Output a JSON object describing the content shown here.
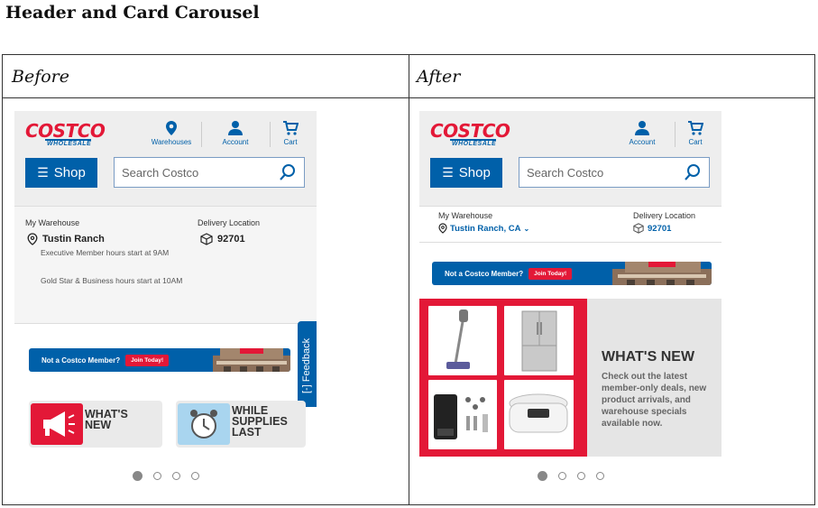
{
  "doc_title": "Header and Card Carousel",
  "columns": {
    "before": "Before",
    "after": "After"
  },
  "header": {
    "logo_main": "COSTCO",
    "logo_sub": "WHOLESALE",
    "warehouses_label": "Warehouses",
    "account_label": "Account",
    "cart_label": "Cart",
    "shop_label": "Shop",
    "search_placeholder": "Search Costco"
  },
  "before": {
    "my_warehouse_label": "My Warehouse",
    "warehouse_name": "Tustin Ranch",
    "delivery_label": "Delivery Location",
    "zip": "92701",
    "note_exec": "Executive Member hours start at 9AM",
    "note_gold": "Gold Star & Business hours start at 10AM",
    "banner_text": "Not a Costco Member?",
    "join_label": "Join Today!",
    "feedback_label": "[-] Feedback",
    "tiles": [
      {
        "line1": "WHAT'S",
        "line2": "NEW"
      },
      {
        "line1": "WHILE",
        "line2": "SUPPLIES",
        "line3": "LAST"
      }
    ]
  },
  "after": {
    "my_warehouse_label": "My Warehouse",
    "warehouse_link": "Tustin Ranch, CA",
    "delivery_label": "Delivery Location",
    "zip": "92701",
    "banner_text": "Not a Costco Member?",
    "join_label": "Join Today!",
    "whats_new_title": "WHAT'S NEW",
    "whats_new_body": "Check out the latest member-only deals, new product arrivals, and warehouse specials available now."
  },
  "carousel": {
    "total_pages": 4,
    "active_page": 1
  },
  "colors": {
    "brand_blue": "#0060a9",
    "brand_red": "#e31837"
  }
}
